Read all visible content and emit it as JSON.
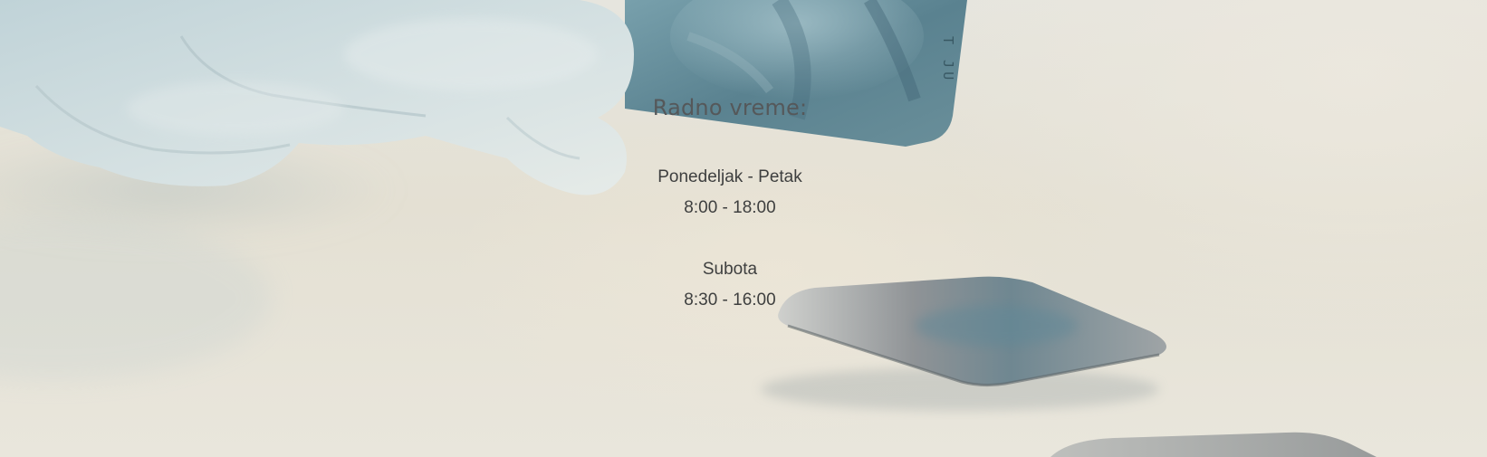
{
  "hours": {
    "title": "Radno vreme:",
    "entries": [
      {
        "day": "Ponedeljak - Petak",
        "time": "8:00 - 18:00"
      },
      {
        "day": "Subota",
        "time": "8:30 - 16:00"
      }
    ]
  },
  "photo": {
    "film_marking": "T JU",
    "colors": {
      "background": "#e4e0d3",
      "glove": "#c9d8dc",
      "xray_film": "#5f8794",
      "text": "#3e3f3f"
    }
  }
}
